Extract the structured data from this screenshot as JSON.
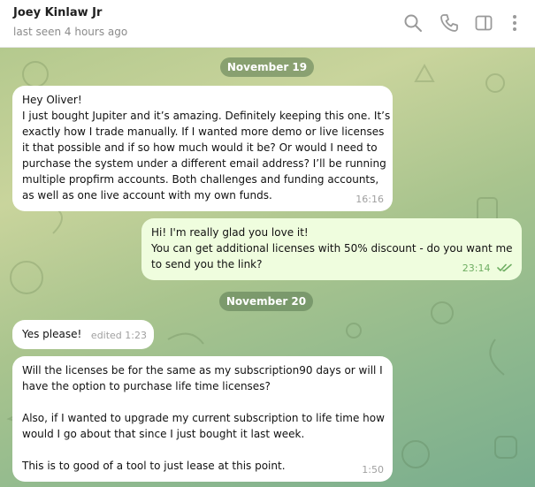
{
  "header": {
    "name": "Joey Kinlaw Jr",
    "status": "last seen 4 hours ago",
    "icons": [
      "search-icon",
      "phone-icon",
      "sidebar-icon",
      "more-icon"
    ]
  },
  "colors": {
    "incoming_bubble": "#ffffff",
    "outgoing_bubble": "#effdde",
    "read_check": "#6fae63",
    "date_pill": "#5a7850"
  },
  "chat": {
    "date1": "November 19",
    "msg1": {
      "lines": [
        "Hey Oliver!",
        "I just bought Jupiter and it’s amazing. Definitely keeping this one. It’s",
        "exactly how I trade manually. If I wanted more demo or live licenses",
        "it that possible and if so how much would it be? Or would I need to",
        "purchase the system under a different email address? I’ll be running",
        "multiple propfirm accounts. Both challenges and funding accounts,",
        "as well as one live account with my own funds."
      ],
      "time": "16:16"
    },
    "msg2": {
      "lines": [
        "Hi! I'm really glad you love it!",
        "You can get additional licenses with 50% discount - do you want me",
        "to send you the link?"
      ],
      "time": "23:14"
    },
    "date2": "November 20",
    "msg3": {
      "text": "Yes please!",
      "edited": "edited 1:23"
    },
    "msg4": {
      "p1": [
        "Will the licenses be for the same as my subscription90 days or will I",
        "have the option to purchase life time licenses?"
      ],
      "p2": [
        "Also, if I wanted to upgrade my current subscription to life time how",
        "would I go about that since I just bought it last week."
      ],
      "p3": [
        "This is to good of a tool to just lease at this point."
      ],
      "time": "1:50"
    }
  }
}
